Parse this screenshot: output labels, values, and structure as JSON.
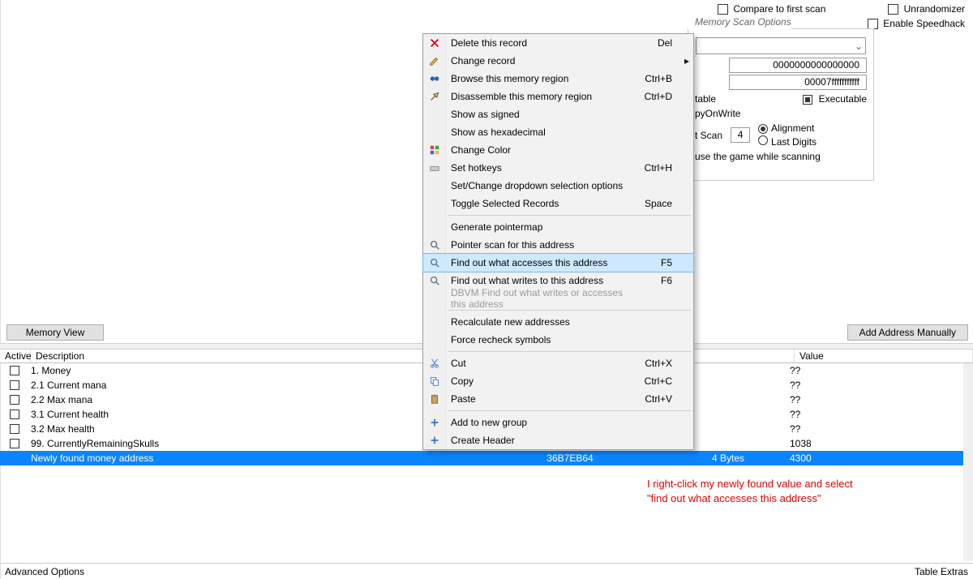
{
  "scan": {
    "compare_label": "Compare to first scan",
    "unrandomizer_label": "Unrandomizer",
    "speedhack_label": "Enable Speedhack",
    "panel_title": "Memory Scan Options",
    "range_start": "0000000000000000",
    "range_stop": "00007fffffffffff",
    "writable_label": "table",
    "executable_label": "Executable",
    "copyonwrite_label": "pyOnWrite",
    "fast_scan_label": "t Scan",
    "fast_scan_value": "4",
    "alignment_label": "Alignment",
    "lastdigits_label": "Last Digits",
    "pause_label": "use the game while scanning"
  },
  "buttons": {
    "memory_view": "Memory View",
    "add_manually": "Add Address Manually"
  },
  "columns": {
    "active": "Active",
    "description": "Description",
    "address": "",
    "type": "",
    "value": "Value"
  },
  "rows": [
    {
      "desc": "1. Money",
      "addr": "",
      "type": "",
      "val": "??"
    },
    {
      "desc": "2.1 Current mana",
      "addr": "",
      "type": "",
      "val": "??"
    },
    {
      "desc": "2.2 Max mana",
      "addr": "",
      "type": "",
      "val": "??"
    },
    {
      "desc": "3.1 Current health",
      "addr": "",
      "type": "",
      "val": "??"
    },
    {
      "desc": "3.2 Max health",
      "addr": "",
      "type": "",
      "val": "??"
    },
    {
      "desc": "99. CurrentlyRemainingSkulls",
      "addr": "",
      "type": "",
      "val": "1038"
    },
    {
      "desc": "Newly found money address",
      "addr": "36B7EB64",
      "type": "4 Bytes",
      "val": "4300",
      "selected": true
    }
  ],
  "ctx": {
    "items": [
      {
        "icon": "x",
        "label": "Delete this record",
        "accel": "Del"
      },
      {
        "icon": "pencil",
        "label": "Change record",
        "submenu": true
      },
      {
        "icon": "binoc",
        "label": "Browse this memory region",
        "accel": "Ctrl+B"
      },
      {
        "icon": "tool",
        "label": "Disassemble this memory region",
        "accel": "Ctrl+D"
      },
      {
        "label": "Show as signed"
      },
      {
        "label": "Show as hexadecimal"
      },
      {
        "icon": "color",
        "label": "Change Color"
      },
      {
        "icon": "keys",
        "label": "Set hotkeys",
        "accel": "Ctrl+H"
      },
      {
        "label": "Set/Change dropdown selection options"
      },
      {
        "label": "Toggle Selected Records",
        "accel": "Space"
      },
      {
        "sep": true
      },
      {
        "label": "Generate pointermap"
      },
      {
        "icon": "mag",
        "label": "Pointer scan for this address"
      },
      {
        "icon": "mag",
        "label": "Find out what accesses this address",
        "accel": "F5",
        "hl": true
      },
      {
        "icon": "mag",
        "label": "Find out what writes to this address",
        "accel": "F6"
      },
      {
        "label": "DBVM Find out what writes or accesses this address",
        "disabled": true
      },
      {
        "sep": true
      },
      {
        "label": "Recalculate new addresses"
      },
      {
        "label": "Force recheck symbols"
      },
      {
        "sep": true
      },
      {
        "icon": "cut",
        "label": "Cut",
        "accel": "Ctrl+X"
      },
      {
        "icon": "copy",
        "label": "Copy",
        "accel": "Ctrl+C"
      },
      {
        "icon": "paste",
        "label": "Paste",
        "accel": "Ctrl+V"
      },
      {
        "sep": true
      },
      {
        "icon": "plus",
        "label": "Add to new group"
      },
      {
        "icon": "plus",
        "label": "Create Header"
      }
    ]
  },
  "status": {
    "left": "Advanced Options",
    "right": "Table Extras"
  },
  "annotation": "I right-click my newly found value and select\n\"find out what accesses this address\""
}
